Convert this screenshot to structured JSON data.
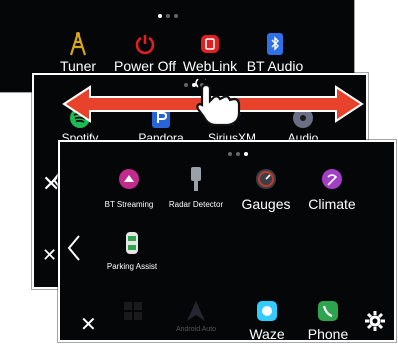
{
  "screen1": {
    "page_dots": [
      true,
      false,
      false
    ],
    "apps": [
      {
        "label": "Tuner",
        "icon": "antenna-tower-icon",
        "color": "#d4a61a"
      },
      {
        "label": "Power Off",
        "icon": "power-icon",
        "color": "#e02020"
      },
      {
        "label": "WebLink",
        "icon": "weblink-icon",
        "color": "#e02020"
      },
      {
        "label": "BT Audio",
        "icon": "bluetooth-audio-icon",
        "color": "#2f6fe8"
      }
    ]
  },
  "screen2": {
    "page_dots": [
      false,
      true,
      false
    ],
    "apps": [
      {
        "label": "Spotify",
        "icon": "spotify-icon",
        "color": "#1db954"
      },
      {
        "label": "Pandora",
        "icon": "pandora-icon",
        "color": "#2766d9"
      },
      {
        "label": "SiriusXM",
        "icon": "siriusxm-icon",
        "color": "#2a7fd9"
      },
      {
        "label": "Audio",
        "icon": "audio-icon",
        "color": "#6b6f86"
      }
    ]
  },
  "screen3": {
    "page_dots": [
      false,
      false,
      true
    ],
    "apps_row1": [
      {
        "label": "BT Streaming",
        "icon": "bt-streaming-icon",
        "color": "#c02b8d"
      },
      {
        "label": "Radar Detector",
        "icon": "radar-detector-icon",
        "color": "#9aa0a8"
      },
      {
        "label": "Gauges",
        "icon": "gauges-icon",
        "color": "#c0392b"
      },
      {
        "label": "Climate",
        "icon": "climate-icon",
        "color": "#a23fc4"
      }
    ],
    "apps_row2": [
      {
        "label": "Parking Assist",
        "icon": "parking-assist-icon",
        "color": "#2ea44f"
      }
    ],
    "dock": [
      {
        "label": "",
        "icon": "grid-icon",
        "color": "#3a3a3a"
      },
      {
        "label": "Android Auto",
        "icon": "android-auto-icon",
        "color": "#4a4f5c"
      },
      {
        "label": "Waze",
        "icon": "waze-icon",
        "color": "#33ccff"
      },
      {
        "label": "Phone",
        "icon": "phone-icon",
        "color": "#2ea44f"
      }
    ]
  },
  "gesture": {
    "icon": "swipe-hand-icon",
    "arrow_color": "#e8432a"
  }
}
